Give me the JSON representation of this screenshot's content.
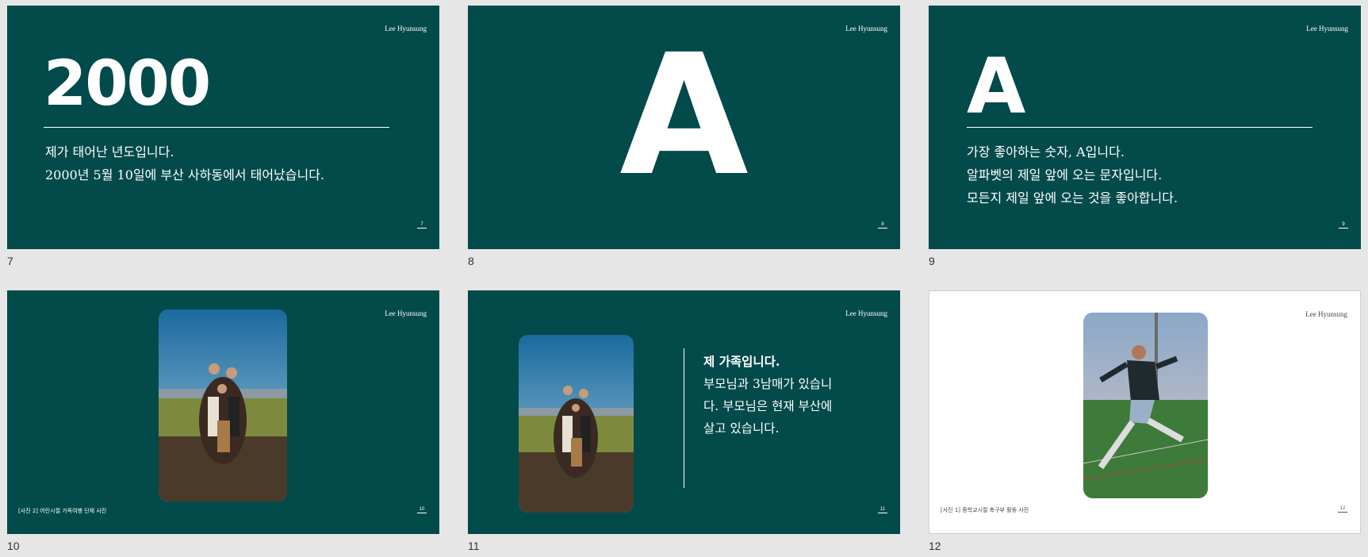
{
  "author": "Lee Hyunsung",
  "slides": [
    {
      "number": "7",
      "page": "7",
      "headline": "2000",
      "lines": [
        "제가 태어난 년도입니다.",
        "2000년 5월 10일에 부산 사하동에서 태어났습니다."
      ]
    },
    {
      "number": "8",
      "page": "8",
      "headline": "A"
    },
    {
      "number": "9",
      "page": "9",
      "headline": "A",
      "lines": [
        "가장 좋아하는 숫자, A입니다.",
        "알파벳의 제일 앞에 오는 문자입니다.",
        "모든지 제일 앞에 오는 것을 좋아합니다."
      ]
    },
    {
      "number": "10",
      "page": "10",
      "caption": "[사진 2] 어린시절 가족여행 단체 사진"
    },
    {
      "number": "11",
      "page": "11",
      "title": "제 가족입니다.",
      "lines": [
        "부모님과 3남매가 있습니",
        "다. 부모님은 현재 부산에",
        "살고 있습니다."
      ]
    },
    {
      "number": "12",
      "page": "12",
      "caption": "[사진 1] 중학교시절 축구부 활동 사진"
    }
  ],
  "colors": {
    "slide_bg": "#034a4b",
    "canvas_bg": "#e6e6e6",
    "text": "#ffffff"
  }
}
